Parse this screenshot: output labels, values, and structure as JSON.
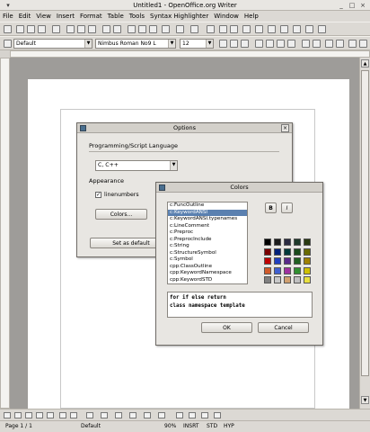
{
  "window": {
    "title": "Untitled1 - OpenOffice.org Writer"
  },
  "menu": [
    "File",
    "Edit",
    "View",
    "Insert",
    "Format",
    "Table",
    "Tools",
    "Syntax Highlighter",
    "Window",
    "Help"
  ],
  "format_bar": {
    "style": "Default",
    "font": "Nimbus Roman No9 L",
    "size": "12"
  },
  "options_dialog": {
    "title": "Options",
    "lang_label": "Programming/Script Language",
    "lang_value": "C, C++",
    "appearance_label": "Appearance",
    "linenumbers_label": "linenumbers",
    "colors_button": "Colors...",
    "default_button": "Set as default"
  },
  "colors_dialog": {
    "title": "Colors",
    "bold_label": "B",
    "italic_label": "I",
    "items": [
      "c:FuncOutline",
      "c:KeywordANSI",
      "c:KeywordANSI.typenames",
      "c:LineComment",
      "c:Preproc",
      "c:PreprocInclude",
      "c:String",
      "c:StructureSymbol",
      "c:Symbol",
      "cpp:ClassOutline",
      "cpp:KeywordNamespace",
      "cpp:KeywordSTD"
    ],
    "selected_index": 1,
    "preview_line1": "for if else return",
    "preview_line2": "class namespace template",
    "ok_label": "OK",
    "cancel_label": "Cancel",
    "swatch_colors": [
      [
        "#000000",
        "#1c1c1c",
        "#2a2a40",
        "#1f3a2a",
        "#2a3a10"
      ],
      [
        "#7a0000",
        "#00207a",
        "#003a3a",
        "#1a4a1a",
        "#6a6a00"
      ],
      [
        "#c00000",
        "#2040c0",
        "#5a2a8a",
        "#206020",
        "#a08000"
      ],
      [
        "#d05a2a",
        "#4060d0",
        "#a030a0",
        "#309030",
        "#d0c000"
      ],
      [
        "#808080",
        "#c8c8c8",
        "#d0a070",
        "#c0c0c0",
        "#e8e040"
      ]
    ]
  },
  "statusbar": {
    "page": "Page 1 / 1",
    "style": "Default",
    "zoom": "90%",
    "insrt": "INSRT",
    "std": "STD",
    "hyp": "HYP"
  }
}
